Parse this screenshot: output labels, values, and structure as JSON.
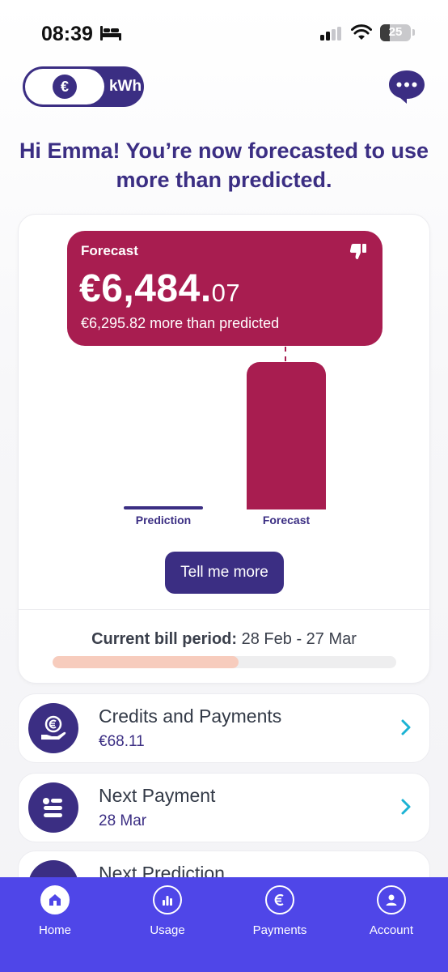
{
  "status_bar": {
    "time": "08:39",
    "battery": "25"
  },
  "unit_toggle": {
    "euro_symbol": "€",
    "kwh_label": "kWh",
    "selected": "€"
  },
  "greeting": "Hi Emma! You’re now forecasted to use more than predicted.",
  "forecast": {
    "label": "Forecast",
    "amount_main": "€6,484.",
    "amount_cents": "07",
    "difference_text": "€6,295.82 more than predicted"
  },
  "chart_data": {
    "type": "bar",
    "categories": [
      "Prediction",
      "Forecast"
    ],
    "values": [
      188.25,
      6484.07
    ],
    "ylim": [
      0,
      6484.07
    ]
  },
  "tell_more_label": "Tell me more",
  "bill_period": {
    "label": "Current bill period:",
    "value": "28 Feb - 27 Mar",
    "progress": 0.54
  },
  "list_items": [
    {
      "title": "Credits and Payments",
      "value": "€68.11"
    },
    {
      "title": "Next Payment",
      "value": "28 Mar"
    },
    {
      "title": "Next Prediction",
      "value": ""
    }
  ],
  "tabs": [
    {
      "label": "Home",
      "active": true
    },
    {
      "label": "Usage",
      "active": false
    },
    {
      "label": "Payments",
      "active": false
    },
    {
      "label": "Account",
      "active": false
    }
  ],
  "colors": {
    "primary": "#3b2e83",
    "forecast": "#a81d50",
    "tab_bar": "#4f46e8",
    "progress": "#f7ccbd",
    "chevron": "#1cb3d4"
  }
}
